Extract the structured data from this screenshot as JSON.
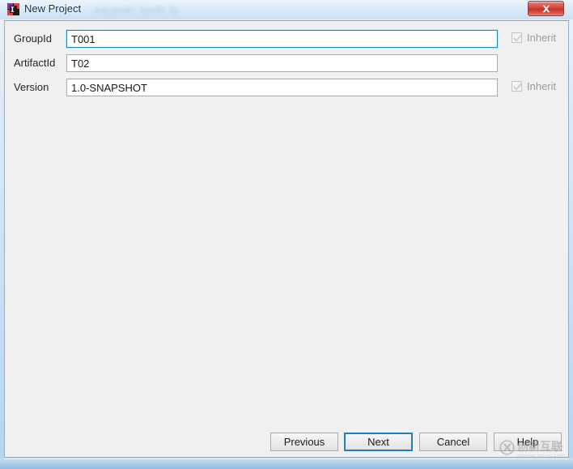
{
  "window": {
    "title": "New Project",
    "app_icon": "intellij-idea-icon",
    "glass_background_text": "skjaskl fjsdl fj",
    "close_label": "x",
    "frame_color": "#b6d4ef",
    "client_background": "#f0f0f0"
  },
  "form": {
    "rows": [
      {
        "label": "GroupId",
        "value": "T001",
        "placeholder": "",
        "focused": true,
        "has_inherit": true,
        "inherit_label": "Inherit",
        "inherit_checked": true,
        "inherit_enabled": false
      },
      {
        "label": "ArtifactId",
        "value": "T02",
        "placeholder": "",
        "focused": false,
        "has_inherit": false,
        "inherit_label": "",
        "inherit_checked": false,
        "inherit_enabled": false
      },
      {
        "label": "Version",
        "value": "1.0-SNAPSHOT",
        "placeholder": "",
        "focused": false,
        "has_inherit": true,
        "inherit_label": "Inherit",
        "inherit_checked": true,
        "inherit_enabled": false
      }
    ]
  },
  "footer": {
    "previous_label": "Previous",
    "next_label": "Next",
    "cancel_label": "Cancel",
    "help_label": "Help",
    "default_button": "Next",
    "focus_color": "#1e7fbe"
  },
  "watermark": {
    "cn_text": "创新互联",
    "pinyin_text": "CHUANG XIN HU LIAN",
    "mark_icon": "circle-x-logo-icon"
  }
}
